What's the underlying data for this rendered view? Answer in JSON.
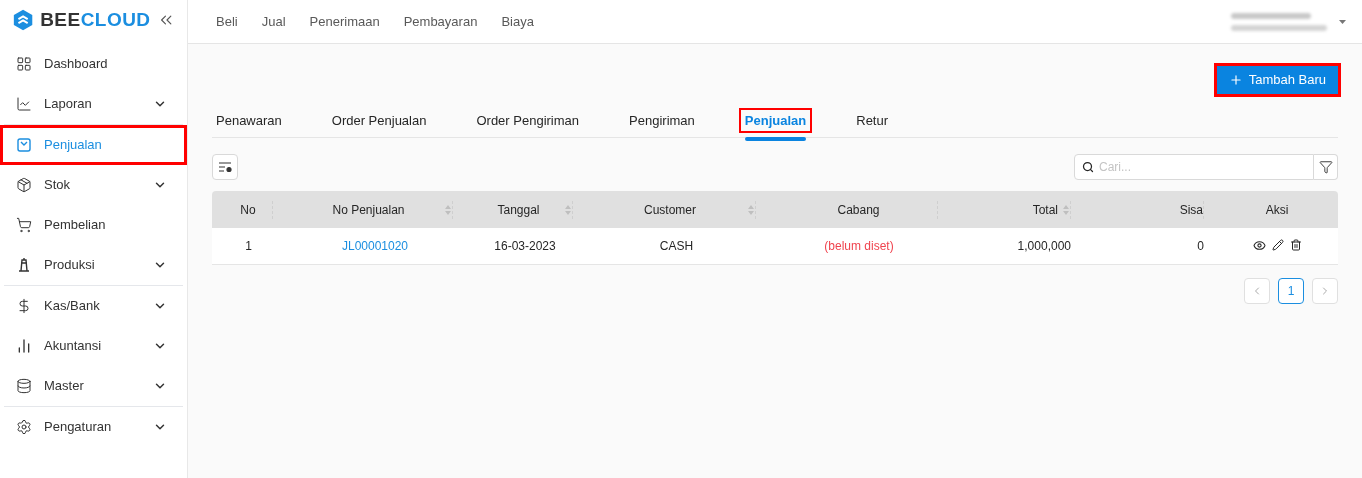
{
  "logo": {
    "parts": [
      {
        "text": "BEE",
        "kind": "dark"
      },
      {
        "text": "CLOUD",
        "kind": "accent"
      }
    ]
  },
  "sidebar": {
    "groups": [
      [
        {
          "label": "Dashboard",
          "expandable": false,
          "selected": false,
          "highlighted": false
        },
        {
          "label": "Laporan",
          "expandable": true,
          "selected": false,
          "highlighted": false
        }
      ],
      [
        {
          "label": "Penjualan",
          "expandable": false,
          "selected": true,
          "highlighted": true
        },
        {
          "label": "Stok",
          "expandable": true,
          "selected": false,
          "highlighted": false
        },
        {
          "label": "Pembelian",
          "expandable": false,
          "selected": false,
          "highlighted": false
        },
        {
          "label": "Produksi",
          "expandable": true,
          "selected": false,
          "highlighted": false
        }
      ],
      [
        {
          "label": "Kas/Bank",
          "expandable": true,
          "selected": false,
          "highlighted": false
        },
        {
          "label": "Akuntansi",
          "expandable": true,
          "selected": false,
          "highlighted": false
        },
        {
          "label": "Master",
          "expandable": true,
          "selected": false,
          "highlighted": false
        }
      ],
      [
        {
          "label": "Pengaturan",
          "expandable": true,
          "selected": false,
          "highlighted": false
        }
      ]
    ]
  },
  "top_menu": [
    "Beli",
    "Jual",
    "Penerimaan",
    "Pembayaran",
    "Biaya"
  ],
  "add_button": {
    "label": "Tambah Baru",
    "highlighted": true
  },
  "tabs": [
    {
      "label": "Penawaran",
      "selected": false,
      "highlighted": false
    },
    {
      "label": "Order Penjualan",
      "selected": false,
      "highlighted": false
    },
    {
      "label": "Order Pengiriman",
      "selected": false,
      "highlighted": false
    },
    {
      "label": "Pengiriman",
      "selected": false,
      "highlighted": false
    },
    {
      "label": "Penjualan",
      "selected": true,
      "highlighted": true
    },
    {
      "label": "Retur",
      "selected": false,
      "highlighted": false
    }
  ],
  "search": {
    "placeholder": "Cari..."
  },
  "table": {
    "columns": [
      {
        "label": "No",
        "sortable": false
      },
      {
        "label": "No Penjualan",
        "sortable": true
      },
      {
        "label": "Tanggal",
        "sortable": true
      },
      {
        "label": "Customer",
        "sortable": true
      },
      {
        "label": "Cabang",
        "sortable": false
      },
      {
        "label": "Total",
        "sortable": true
      },
      {
        "label": "Sisa",
        "sortable": false
      },
      {
        "label": "Aksi",
        "sortable": false
      }
    ],
    "rows": [
      {
        "cells": [
          {
            "text": "1",
            "kind": "text"
          },
          {
            "text": "JL00001020",
            "kind": "link"
          },
          {
            "text": "16-03-2023",
            "kind": "text"
          },
          {
            "text": "CASH",
            "kind": "text"
          },
          {
            "text": "(belum diset)",
            "kind": "warning"
          },
          {
            "text": "1,000,000",
            "kind": "text"
          },
          {
            "text": "0",
            "kind": "text"
          },
          {
            "kind": "actions"
          }
        ]
      }
    ]
  },
  "pagination": {
    "pages": [
      {
        "label": "1",
        "selected": true
      }
    ]
  }
}
